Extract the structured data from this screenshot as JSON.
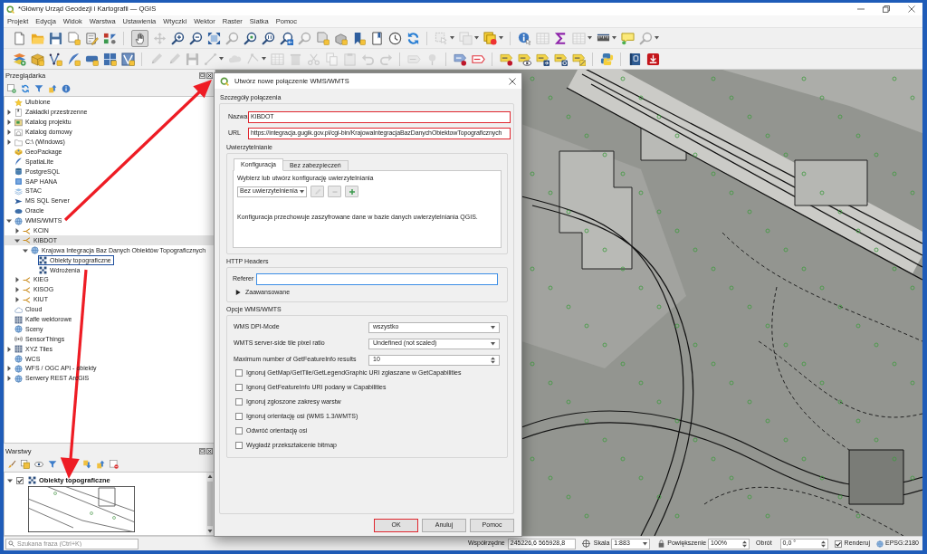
{
  "window": {
    "title": "*Główny Urząd Geodezji i Kartografii — QGIS"
  },
  "menu": [
    "Projekt",
    "Edycja",
    "Widok",
    "Warstwa",
    "Ustawienia",
    "Wtyczki",
    "Wektor",
    "Raster",
    "Siatka",
    "Pomoc"
  ],
  "toolbars": [
    {
      "groups": [
        [
          {
            "kind": "new",
            "disabled": false
          },
          {
            "kind": "open",
            "disabled": false
          },
          {
            "kind": "save",
            "disabled": false
          },
          {
            "kind": "saveas",
            "disabled": false
          },
          {
            "kind": "print",
            "disabled": false
          },
          {
            "kind": "style",
            "disabled": false
          }
        ],
        [
          {
            "kind": "pan",
            "disabled": false,
            "pressed": true
          },
          {
            "kind": "pantosel",
            "disabled": true
          },
          {
            "kind": "zoomin",
            "disabled": false
          },
          {
            "kind": "zoomout",
            "disabled": false
          },
          {
            "kind": "zoomfull",
            "disabled": false
          },
          {
            "kind": "zoomsel",
            "disabled": true
          },
          {
            "kind": "zoomlayer",
            "disabled": false
          },
          {
            "kind": "zoomnative",
            "disabled": false
          },
          {
            "kind": "zoomlast",
            "disabled": false
          },
          {
            "kind": "zoomnext",
            "disabled": true
          },
          {
            "kind": "mapview",
            "disabled": false
          },
          {
            "kind": "map3d",
            "disabled": false
          },
          {
            "kind": "bookmark",
            "disabled": false
          },
          {
            "kind": "bookmarks",
            "disabled": false
          },
          {
            "kind": "temporal",
            "disabled": false
          },
          {
            "kind": "refresh",
            "disabled": false
          }
        ],
        [
          {
            "kind": "select",
            "disabled": true,
            "dropdown": true
          },
          {
            "kind": "deselect",
            "disabled": true,
            "dropdown": true
          },
          {
            "kind": "layersel",
            "disabled": false,
            "dropdown": true
          }
        ],
        [
          {
            "kind": "identify",
            "disabled": false
          },
          {
            "kind": "table",
            "disabled": true
          },
          {
            "kind": "stats",
            "disabled": false
          },
          {
            "kind": "calc",
            "disabled": true,
            "dropdown": true
          },
          {
            "kind": "measure",
            "disabled": false,
            "dropdown": true
          },
          {
            "kind": "tips",
            "disabled": false
          },
          {
            "kind": "locator",
            "disabled": true,
            "dropdown": true
          }
        ]
      ]
    },
    {
      "groups": [
        [
          {
            "kind": "addlayer",
            "disabled": false
          },
          {
            "kind": "newgpkg",
            "disabled": false
          },
          {
            "kind": "newshp",
            "disabled": false
          },
          {
            "kind": "newspatialite",
            "disabled": false
          },
          {
            "kind": "newmemory",
            "disabled": false
          },
          {
            "kind": "newvirtual",
            "disabled": false
          },
          {
            "kind": "newmesh",
            "disabled": false
          }
        ],
        [
          {
            "kind": "edits",
            "disabled": true
          },
          {
            "kind": "toggleedit",
            "disabled": true
          },
          {
            "kind": "saveedits",
            "disabled": true
          },
          {
            "kind": "digitize",
            "disabled": true,
            "dropdown": true
          },
          {
            "kind": "polygon",
            "disabled": true
          },
          {
            "kind": "vertex",
            "disabled": true,
            "dropdown": true
          },
          {
            "kind": "editattr",
            "disabled": true
          },
          {
            "kind": "delete",
            "disabled": true
          },
          {
            "kind": "cut",
            "disabled": true
          },
          {
            "kind": "copy",
            "disabled": true
          },
          {
            "kind": "paste",
            "disabled": true
          },
          {
            "kind": "undo",
            "disabled": true
          },
          {
            "kind": "redo",
            "disabled": true
          }
        ],
        [
          {
            "kind": "labeltool",
            "disabled": true
          },
          {
            "kind": "pin",
            "disabled": true
          }
        ],
        [
          {
            "kind": "labelpin",
            "disabled": false
          },
          {
            "kind": "labelred",
            "disabled": false
          }
        ],
        [
          {
            "kind": "labpin",
            "disabled": false
          },
          {
            "kind": "labshow",
            "disabled": false
          },
          {
            "kind": "labmove",
            "disabled": false
          },
          {
            "kind": "labrotate",
            "disabled": false
          },
          {
            "kind": "labedit",
            "disabled": false
          }
        ],
        [
          {
            "kind": "python",
            "disabled": false
          }
        ],
        [
          {
            "kind": "help",
            "disabled": false
          },
          {
            "kind": "plugin",
            "disabled": false
          }
        ]
      ]
    }
  ],
  "browser": {
    "title": "Przeglądarka",
    "tools": [
      {
        "kind": "add"
      },
      {
        "kind": "refresh"
      },
      {
        "kind": "filter"
      },
      {
        "kind": "collapse"
      },
      {
        "kind": "info"
      }
    ],
    "tree": [
      {
        "label": "Ulubione",
        "kind": "favorites",
        "selected": false,
        "hovered": false
      },
      {
        "label": "Zakładki przestrzenne",
        "kind": "spatialbookmarks",
        "expanded": false,
        "selected": false,
        "hovered": false
      },
      {
        "label": "Katalog projektu",
        "kind": "project",
        "expanded": false,
        "selected": false,
        "hovered": false
      },
      {
        "label": "Katalog domowy",
        "kind": "home",
        "expanded": false,
        "selected": false,
        "hovered": false
      },
      {
        "label": "C:\\ (Windows)",
        "kind": "drive",
        "expanded": false,
        "selected": false,
        "hovered": false
      },
      {
        "label": "GeoPackage",
        "kind": "geopackage",
        "selected": false,
        "hovered": false
      },
      {
        "label": "SpatiaLite",
        "kind": "spatialite",
        "selected": false,
        "hovered": false
      },
      {
        "label": "PostgreSQL",
        "kind": "postgres",
        "selected": false,
        "hovered": false
      },
      {
        "label": "SAP HANA",
        "kind": "hana",
        "selected": false,
        "hovered": false
      },
      {
        "label": "STAC",
        "kind": "stac",
        "selected": false,
        "hovered": false
      },
      {
        "label": "MS SQL Server",
        "kind": "mssql",
        "selected": false,
        "hovered": false
      },
      {
        "label": "Oracle",
        "kind": "oracle",
        "selected": false,
        "hovered": false
      },
      {
        "label": "WMS/WMTS",
        "kind": "wms",
        "expanded": true,
        "selected": false,
        "hovered": false,
        "children": [
          {
            "label": "KCIN",
            "kind": "connection",
            "expanded": false,
            "selected": false,
            "hovered": false
          },
          {
            "label": "KIBDOT",
            "kind": "connection",
            "expanded": true,
            "selected": false,
            "hovered": true,
            "children": [
              {
                "label": "Krajowa Integracja Baz Danych Obiektów Topograficznych",
                "kind": "wms",
                "expanded": true,
                "selected": false,
                "hovered": false,
                "children": [
                  {
                    "label": "Obiekty topograficzne",
                    "kind": "layer",
                    "selected": true,
                    "hovered": false
                  },
                  {
                    "label": "Wdrożenia",
                    "kind": "layer",
                    "selected": false,
                    "hovered": false
                  }
                ]
              }
            ]
          },
          {
            "label": "KIEG",
            "kind": "connection",
            "expanded": false,
            "selected": false,
            "hovered": false
          },
          {
            "label": "KISOG",
            "kind": "connection",
            "expanded": false,
            "selected": false,
            "hovered": false
          },
          {
            "label": "KIUT",
            "kind": "connection",
            "expanded": false,
            "selected": false,
            "hovered": false
          }
        ]
      },
      {
        "label": "Cloud",
        "kind": "cloud",
        "selected": false,
        "hovered": false
      },
      {
        "label": "Kafle wektorowe",
        "kind": "vectortiles",
        "selected": false,
        "hovered": false
      },
      {
        "label": "Sceny",
        "kind": "scenes",
        "selected": false,
        "hovered": false
      },
      {
        "label": "SensorThings",
        "kind": "sensorthings",
        "selected": false,
        "hovered": false
      },
      {
        "label": "XYZ Tiles",
        "kind": "xyz",
        "expanded": false,
        "selected": false,
        "hovered": false
      },
      {
        "label": "WCS",
        "kind": "wcs",
        "selected": false,
        "hovered": false
      },
      {
        "label": "WFS / OGC API - obiekty",
        "kind": "wfs",
        "expanded": false,
        "selected": false,
        "hovered": false
      },
      {
        "label": "Serwery REST ArcGIS",
        "kind": "arcgis",
        "expanded": false,
        "selected": false,
        "hovered": false
      }
    ]
  },
  "layers_panel": {
    "title": "Warstwy",
    "tools": [
      [
        {
          "kind": "brush"
        },
        {
          "kind": "group"
        },
        {
          "kind": "themes"
        },
        {
          "kind": "filter"
        }
      ],
      [
        {
          "kind": "expandall"
        },
        {
          "kind": "collapseall"
        },
        {
          "kind": "remove"
        }
      ]
    ],
    "layers": [
      {
        "label": "Obiekty topograficzne",
        "kind": "layer",
        "expanded": true,
        "checked": true
      }
    ]
  },
  "dialog": {
    "title": "Utwórz nowe połączenie WMS/WMTS",
    "details": {
      "title": "Szczegóły połączenia",
      "fields": [
        {
          "label": "Nazwa",
          "value": "KIBDOT",
          "highlighted": true
        },
        {
          "label": "URL",
          "value": "https://integracja.gugik.gov.pl/cgi-bin/KrajowaIntegracjaBazDanychObiektowTopograficznych",
          "highlighted": true
        }
      ]
    },
    "authentication": {
      "title": "Uwierzytelnianie",
      "tabs": [
        {
          "label": "Konfiguracja",
          "selected": true
        },
        {
          "label": "Bez zabezpieczeń",
          "selected": false
        }
      ],
      "prompt": "Wybierz lub utwórz konfigurację uwierzytelniania",
      "config": {
        "value": "Bez uwierzytelnienia"
      },
      "actions": [
        {
          "kind": "edit",
          "disabled": true
        },
        {
          "kind": "remove",
          "disabled": true
        },
        {
          "kind": "add",
          "disabled": false
        }
      ],
      "note": "Konfiguracja przechowuje zaszyfrowane dane w bazie danych uwierzytelniania QGIS."
    },
    "http_headers": {
      "title": "HTTP Headers",
      "referer": {
        "label": "Referer",
        "focused": true
      },
      "advanced": {
        "label": "Zaawansowane",
        "expanded": false
      }
    },
    "options": {
      "title": "Opcje WMS/WMTS",
      "settings": [
        {
          "kind": "combo",
          "label": "WMS DPI-Mode",
          "value": "wszystko"
        },
        {
          "kind": "combo",
          "label": "WMTS server-side tile pixel ratio",
          "value": "Undefined (not scaled)"
        },
        {
          "kind": "spin",
          "label": "Maximum number of GetFeatureInfo results",
          "value": "10"
        }
      ],
      "checkboxes": [
        {
          "label": "Ignoruj GetMap/GetTile/GetLegendGraphic URI zgłaszane w GetCapabilities",
          "checked": false
        },
        {
          "label": "Ignoruj GetFeatureInfo URI podany w Capabilities",
          "checked": false
        },
        {
          "label": "Ignoruj zgłoszone zakresy warstw",
          "checked": false
        },
        {
          "label": "Ignoruj orientację osi (WMS 1.3/WMTS)",
          "checked": false
        },
        {
          "label": "Odwróć orientację osi",
          "checked": false
        },
        {
          "label": "Wygładź przekształcenie bitmap",
          "checked": false
        }
      ]
    },
    "buttons": [
      {
        "label": "OK",
        "highlighted": true
      },
      {
        "label": "Anuluj",
        "highlighted": false
      },
      {
        "label": "Pomoc",
        "highlighted": false
      }
    ]
  },
  "status_bar": {
    "search": {
      "placeholder": "Szukana fraza (Ctrl+K)"
    },
    "coordinates": {
      "label": "Współrzędne",
      "value": "245226,6 565928,8"
    },
    "scale": {
      "label": "Skala",
      "value": "1:883"
    },
    "magnifier": {
      "label": "Powiększenie",
      "value": "100%"
    },
    "rotation": {
      "label": "Obrót",
      "value": "0,0 °"
    },
    "render": {
      "label": "Renderuj",
      "checked": true
    },
    "crs": {
      "label": "EPSG:2180"
    }
  },
  "annotations": [
    {
      "kind": "arrow"
    },
    {
      "kind": "arrow"
    }
  ]
}
